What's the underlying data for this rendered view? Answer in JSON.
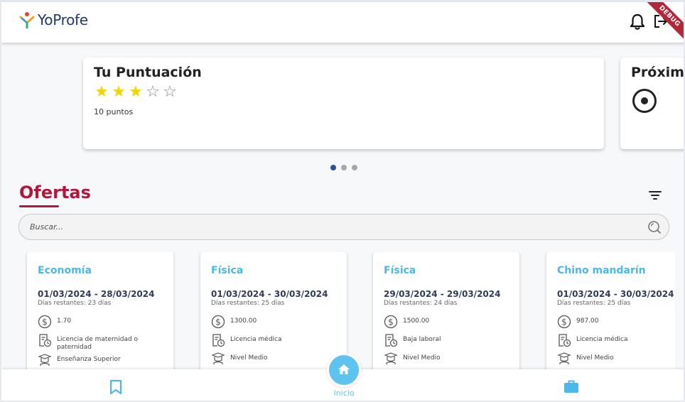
{
  "header": {
    "app_name": "YoProfe",
    "debug_label": "DEBUG",
    "icons": [
      "bell-icon",
      "logout-icon"
    ]
  },
  "carousel": {
    "score_card": {
      "title": "Tu Puntuación",
      "rating": 3,
      "max_rating": 5,
      "points": "10 puntos"
    },
    "next_card": {
      "title": "Próxim"
    },
    "page_count": 3,
    "active_page": 0
  },
  "ofertas": {
    "title": "Ofertas",
    "search_placeholder": "Buscar...",
    "cards": [
      {
        "subject": "Economía",
        "dates": "01/03/2024 - 28/03/2024",
        "remaining": "Días restantes: 23 días",
        "amount": "1.70",
        "reason": "Licencia de maternidad o paternidad",
        "level": "Enseñanza Superior"
      },
      {
        "subject": "Física",
        "dates": "01/03/2024 - 30/03/2024",
        "remaining": "Días restantes: 25 días",
        "amount": "1300.00",
        "reason": "Licencia médica",
        "level": "Nivel Medio"
      },
      {
        "subject": "Física",
        "dates": "29/03/2024 - 29/03/2024",
        "remaining": "Días restantes: 24 días",
        "amount": "1500.00",
        "reason": "Baja laboral",
        "level": "Nivel Medio"
      },
      {
        "subject": "Chino mandarín",
        "dates": "01/03/2024 - 30/03/2024",
        "remaining": "Días restantes: 25 días",
        "amount": "987.00",
        "reason": "Licencia médica",
        "level": "Nivel Medio"
      }
    ]
  },
  "bottom_nav": {
    "home_label": "Inicio"
  },
  "colors": {
    "brand_red": "#b0173a",
    "accent_blue": "#5ec4ee",
    "star": "#f5d400",
    "dates": "#2f3b5a"
  }
}
